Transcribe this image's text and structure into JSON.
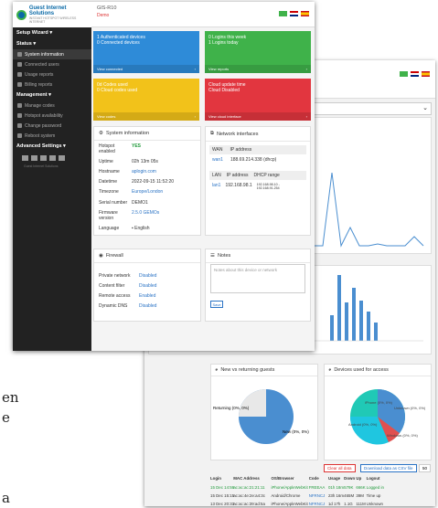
{
  "bg_text": [
    "en",
    "e",
    "a"
  ],
  "app": {
    "logo_name": "Guest Internet Solutions",
    "logo_tag": "INSTANT HOTSPOT WIRELESS INTERNET",
    "serial_header": "GIS-R10",
    "demo_label": "Demo"
  },
  "sidebar": {
    "setup": "Setup Wizard",
    "status": "Status",
    "status_items": [
      "System information",
      "Connected users",
      "Usage reports",
      "Billing reports"
    ],
    "management": "Management",
    "management_items": [
      "Manage codes",
      "Hotspot availability",
      "Change password",
      "Reboot system"
    ],
    "advanced": "Advanced Settings",
    "footer": "Guest Internet Solutions"
  },
  "tiles": [
    {
      "l1": "1 Authenticated devices",
      "l2": "0 Connected devices",
      "foot": "View connected",
      "color": "#2e8bd8"
    },
    {
      "l1": "0 Logins this week",
      "l2": "1 Logins today",
      "foot": "View reports",
      "color": "#3fb24a"
    },
    {
      "l1": "0d Codes used",
      "l2": "0 Cloud codes used",
      "foot": "View codes",
      "color": "#f2c21a"
    },
    {
      "l1": "Cloud update time",
      "l2": "Cloud Disabled",
      "foot": "View cloud interface",
      "color": "#e2363f"
    }
  ],
  "system_info": {
    "title": "System information",
    "rows": [
      {
        "k": "Hotspot enabled",
        "v": "YES",
        "cls": "ok"
      },
      {
        "k": "Uptime",
        "v": "02h 13m 05s",
        "cls": ""
      },
      {
        "k": "Hostname",
        "v": "aplogin.com",
        "cls": "link"
      },
      {
        "k": "Datetime",
        "v": "2022-09-15 11:52:20",
        "cls": ""
      },
      {
        "k": "Timezone",
        "v": "Europe/London",
        "cls": "link"
      },
      {
        "k": "Serial number",
        "v": "DEMO1",
        "cls": ""
      },
      {
        "k": "Firmware version",
        "v": "2.5.0  GEMOs",
        "cls": "link"
      },
      {
        "k": "Language",
        "v": "English",
        "cls": ""
      }
    ]
  },
  "network": {
    "title": "Network interfaces",
    "wan_label": "WAN",
    "wan_head": "IP address",
    "wan_if": "wan1",
    "wan_ip": "188.69.214.338 (dhcp)",
    "lan_label": "LAN",
    "lan_head_ip": "IP address",
    "lan_head_dhcp": "DHCP range",
    "lan_if": "lan1",
    "lan_ip": "192.168.98.1",
    "lan_range": "192.168.98.10 - 192.168.91.254"
  },
  "firewall": {
    "title": "Firewall",
    "rows": [
      {
        "k": "Private network",
        "v": "Disabled"
      },
      {
        "k": "Content filter",
        "v": "Disabled"
      },
      {
        "k": "Remote access",
        "v": "Enabled"
      },
      {
        "k": "Dynamic DNS",
        "v": "Disabled"
      }
    ]
  },
  "notes": {
    "title": "Notes",
    "placeholder": "Notes about this device or network",
    "save": "Save"
  },
  "back_window": {
    "pie1_title": "New vs returning guests",
    "pie1_labels": [
      "Returning (0%, 0%)",
      "New (0%, 0%)"
    ],
    "pie2_title": "Devices used for access",
    "pie2_labels": [
      "iPhone (0%, 0%)",
      "Android (0%, 0%)",
      "Windows (0%, 0%)",
      "Unknown (0%, 0%)"
    ],
    "clear_btn": "Clear all data",
    "download_btn": "Download data as CSV file",
    "page_size": "50",
    "table_headers": [
      "Login",
      "MAC Address",
      "OS/Browser",
      "Code",
      "Usage",
      "Down",
      "Up",
      "Logout"
    ],
    "table_rows": [
      [
        "15 Dec 14:59",
        "ac:ac:ac:21:21:11",
        "iPhone/AppleWebKit",
        "FREEAA",
        "01h 18m",
        "579K",
        "666K",
        "Logged in"
      ],
      [
        "15 Dec 15:15",
        "ac:ac:4e:2e:a4:3c",
        "Android/Chrome",
        "NFRNCJ",
        "23h 16m",
        "465M",
        "39M",
        "Time up"
      ],
      [
        "13 Dec 20:33",
        "ac:ac:ac:39:ad:5a",
        "iPhone/AppleWebKit",
        "NFRNCJ",
        "1d 17h",
        "1.1G",
        "111M",
        "Unknown"
      ]
    ]
  },
  "colors": {
    "sidebar": "#222222",
    "blue": "#2e8bd8",
    "green": "#3fb24a",
    "yellow": "#f2c21a",
    "red": "#e2363f",
    "pie_blue": "#4a8ed0",
    "pie_teal": "#20c9b6",
    "pie_cyan": "#1fc6e0",
    "pie_red": "#e05050"
  }
}
